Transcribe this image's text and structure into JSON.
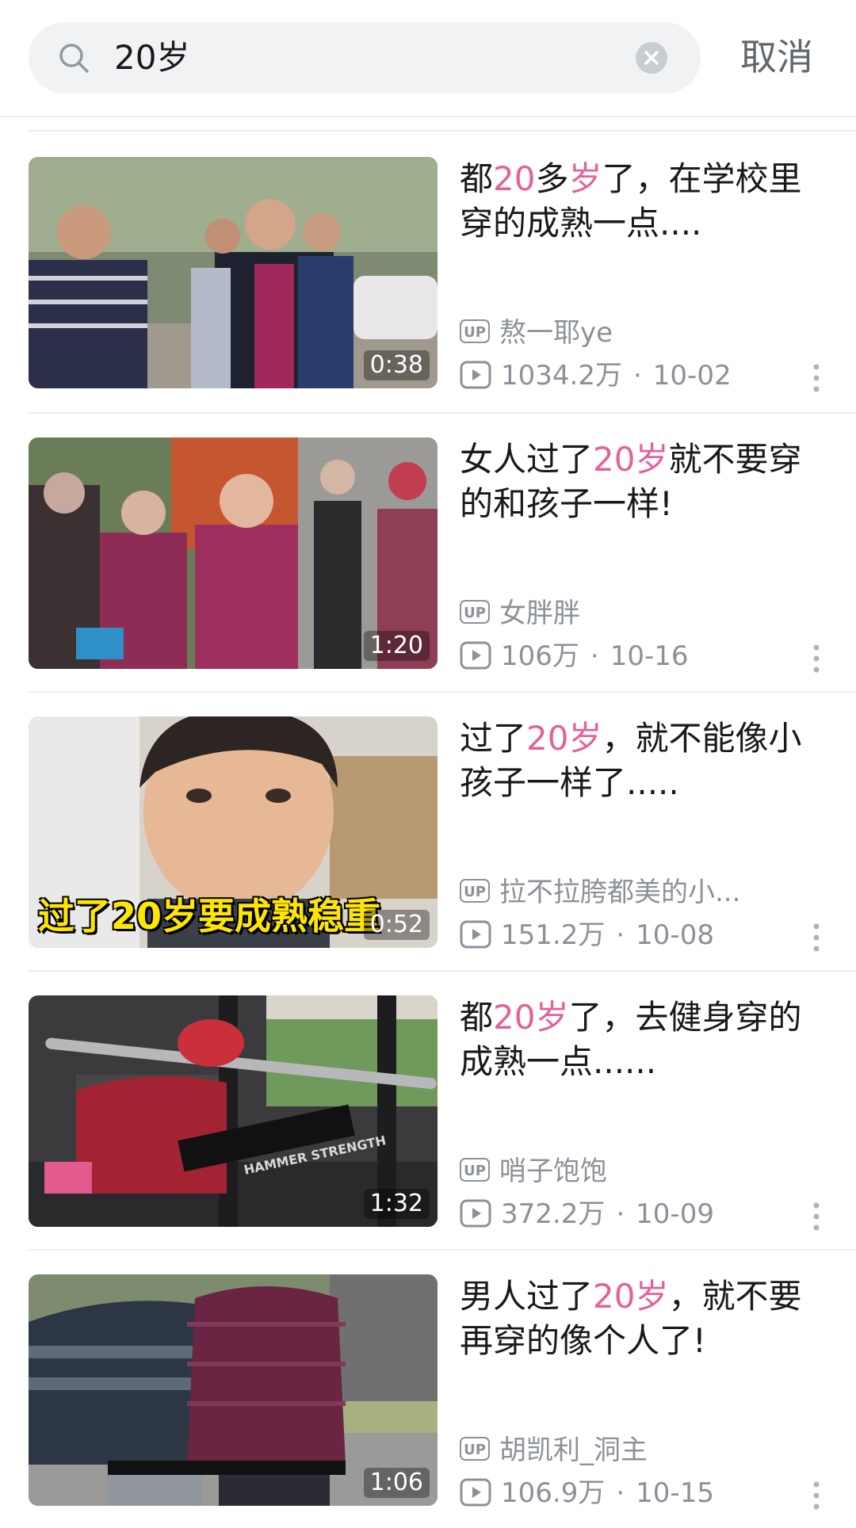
{
  "search": {
    "query": "20岁",
    "cancel_label": "取消"
  },
  "results": [
    {
      "title_parts": [
        "都",
        "20",
        "多",
        "岁",
        "了，在学校里穿的成熟一点...."
      ],
      "author": "熬一耶ye",
      "views": "1034.2万",
      "date": "10-02",
      "duration": "0:38"
    },
    {
      "title_parts": [
        "女人过了",
        "20岁",
        "就不要穿的和孩子一样!"
      ],
      "author": "女胖胖",
      "views": "106万",
      "date": "10-16",
      "duration": "1:20"
    },
    {
      "title_parts": [
        "过了",
        "20岁",
        "，就不能像小孩子一样了....."
      ],
      "author": "拉不拉胯都美的小...",
      "views": "151.2万",
      "date": "10-08",
      "duration": "0:52",
      "caption": "过了20岁要成熟稳重"
    },
    {
      "title_parts": [
        "都",
        "20岁",
        "了，去健身穿的成熟一点......"
      ],
      "author": "哨子饱饱",
      "views": "372.2万",
      "date": "10-09",
      "duration": "1:32",
      "thumb_text": "HAMMER STRENGTH"
    },
    {
      "title_parts": [
        "男人过了",
        "20岁",
        "，就不要再穿的像个人了!"
      ],
      "author": "胡凯利_洞主",
      "views": "106.9万",
      "date": "10-15",
      "duration": "1:06"
    }
  ],
  "labels": {
    "up_badge": "UP",
    "separator": "·"
  },
  "colors": {
    "highlight": "#e5609b",
    "meta_text": "#8c9099",
    "search_bg": "#f1f2f3"
  }
}
